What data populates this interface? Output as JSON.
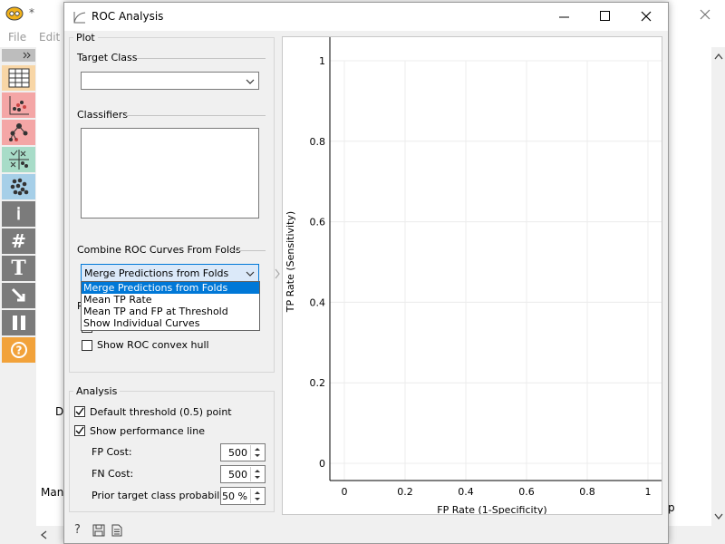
{
  "background_window": {
    "title_marker": "*",
    "menu": [
      "File",
      "Edit"
    ],
    "partial_labels": [
      "Di",
      "Mani",
      "p"
    ]
  },
  "dialog": {
    "title": "ROC Analysis",
    "plot_group": {
      "title": "Plot",
      "target_class_label": "Target Class",
      "target_class_value": "",
      "classifiers_label": "Classifiers",
      "combine_label": "Combine ROC Curves From Folds",
      "combine_value": "Merge Predictions from Folds",
      "combine_options": [
        "Merge Predictions from Folds",
        "Mean TP Rate",
        "Mean TP and FP at Threshold",
        "Show Individual Curves"
      ],
      "hidden_label_fragment": "R",
      "show_convex_hull_label": "Show ROC convex hull"
    },
    "analysis_group": {
      "title": "Analysis",
      "default_threshold_label": "Default threshold (0.5) point",
      "show_performance_line_label": "Show performance line",
      "fp_cost_label": "FP Cost:",
      "fp_cost_value": "500",
      "fn_cost_label": "FN Cost:",
      "fn_cost_value": "500",
      "prior_label": "Prior target class probability:",
      "prior_value": "50 %"
    }
  },
  "chart_data": {
    "type": "line",
    "title": "",
    "xlabel": "FP Rate (1-Specificity)",
    "ylabel": "TP Rate (Sensitivity)",
    "xlim": [
      0,
      1
    ],
    "ylim": [
      0,
      1
    ],
    "x_ticks": [
      "0",
      "0.2",
      "0.4",
      "0.6",
      "0.8",
      "1"
    ],
    "y_ticks": [
      "0",
      "0.2",
      "0.4",
      "0.6",
      "0.8",
      "1"
    ],
    "grid": true,
    "series": []
  }
}
